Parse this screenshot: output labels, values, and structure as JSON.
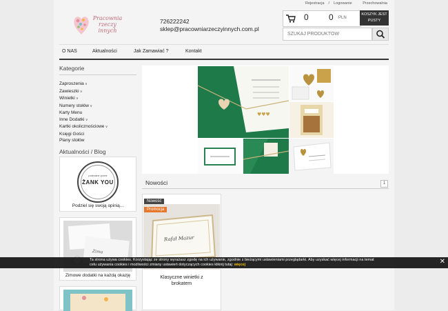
{
  "header": {
    "register": "Rejestracja",
    "separator": "/",
    "login": "Logowanie",
    "storage": "Przechowalnia",
    "logo_text": [
      "Pracownia",
      "rzeczy",
      "innych"
    ],
    "phone": "726222242",
    "email": "sklep@pracowniarzeczyinnych.com.pl"
  },
  "cart": {
    "quantity": "0",
    "amount": "0",
    "currency": "PLN",
    "button_line1": "KOSZYK JEST",
    "button_line2": "PUSTY"
  },
  "search": {
    "placeholder": "SZUKAJ PRODUKTÓW"
  },
  "nav": [
    "O NAS",
    "Aktualności",
    "Jak Zamawiać ?",
    "Kontakt"
  ],
  "sidebar": {
    "categories_heading": "Kategorie",
    "categories": [
      {
        "label": "Zaproszenia",
        "has_sub": true
      },
      {
        "label": "Zawieszki",
        "has_sub": true
      },
      {
        "label": "Winietki",
        "has_sub": true
      },
      {
        "label": "Numery stołów",
        "has_sub": true
      },
      {
        "label": "Karty Menu",
        "has_sub": false
      },
      {
        "label": "Inne Dodatki",
        "has_sub": true
      },
      {
        "label": "Kartki okolicznościowe",
        "has_sub": true
      },
      {
        "label": "Księgi Gości",
        "has_sub": false
      },
      {
        "label": "Plany stołów",
        "has_sub": false
      }
    ],
    "blog_heading": "Aktualności / Blog",
    "badge_small": "polecane przez",
    "badge_big": "ŻANK YOU",
    "card1_caption": "Podziel się swoją opinią...",
    "card2_caption": "Zimowe dodatki na każdą okazję"
  },
  "news": {
    "heading": "Nowości",
    "page": "1"
  },
  "product": {
    "tag_new": "Nowość",
    "tag_promo": "Promocja",
    "card_name": "Rafał Mazur",
    "title_line1": "Klasyczne winietki z",
    "title_line2": "brokatem"
  },
  "cookie": {
    "text": "Ta strona używa cookies. Korzystając ze strony wyrażasz zgodę na ich używanie, zgodnie z bieżącymi ustawieniami przeglądarki. Aby uzyskać więcej informacji na temat celu używania cookies i możliwości zmiany ustawień dotyczących cookies kliknij tutaj:",
    "more": "więcej",
    "close": "✕"
  },
  "colors": {
    "accent": "#1d7a45",
    "promo": "#e8772e",
    "dark": "#333333"
  }
}
